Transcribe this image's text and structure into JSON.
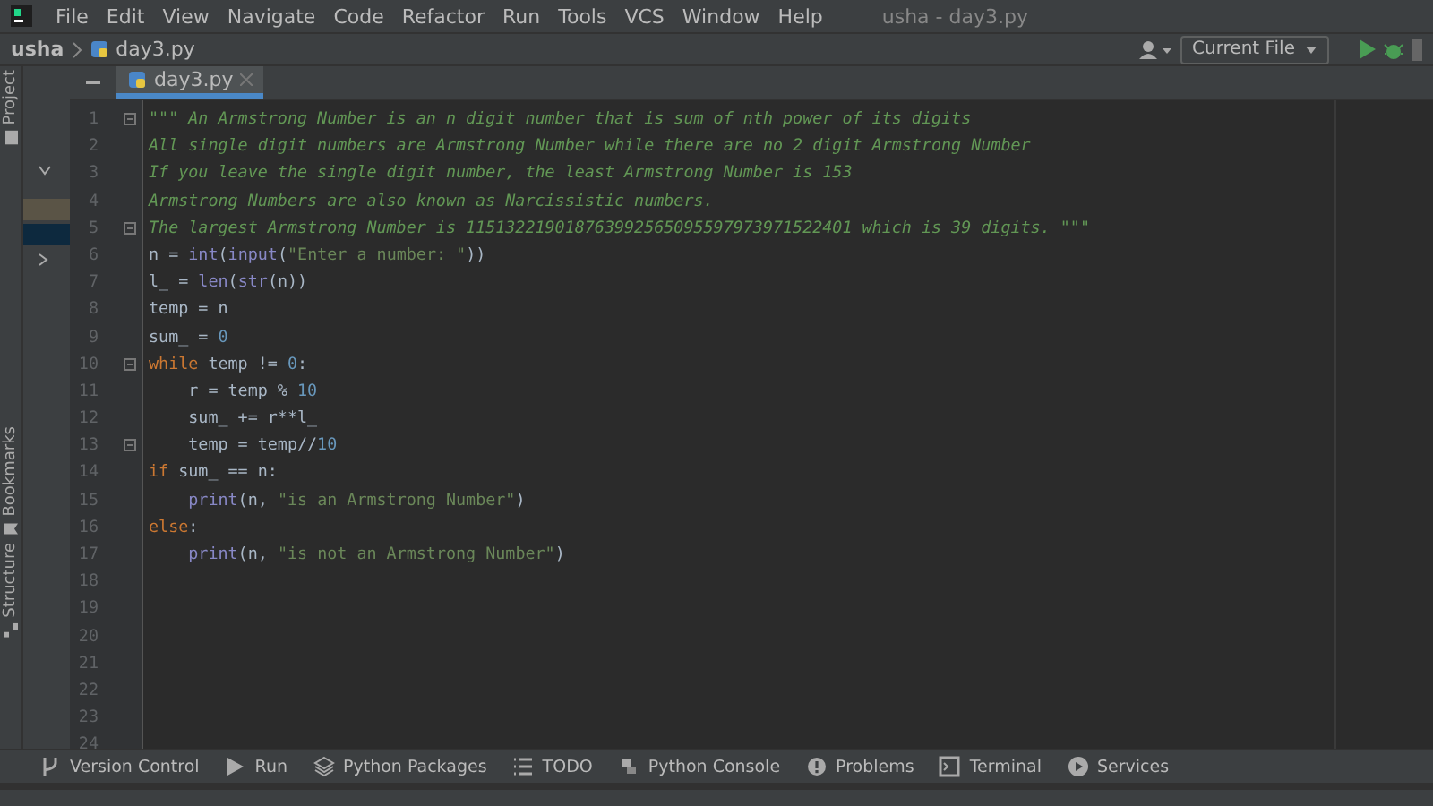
{
  "window": {
    "title": "usha - day3.py"
  },
  "menu": [
    "File",
    "Edit",
    "View",
    "Navigate",
    "Code",
    "Refactor",
    "Run",
    "Tools",
    "VCS",
    "Window",
    "Help"
  ],
  "navbar": {
    "project": "usha",
    "file": "day3.py",
    "run_config": "Current File"
  },
  "left_stripe": [
    "Project",
    "Bookmarks",
    "Structure"
  ],
  "tabs": [
    {
      "label": "day3.py",
      "selected": true
    }
  ],
  "editor": {
    "lines": [
      {
        "number": "1",
        "fold": true,
        "indented": false,
        "tokens": [
          {
            "kind": "doc",
            "t": "\"\"\" An Armstrong Number is an n digit number that is sum of nth power of its digits"
          }
        ]
      },
      {
        "number": "2",
        "fold": false,
        "indented": false,
        "tokens": [
          {
            "kind": "doc",
            "t": "All single digit numbers are Armstrong Number while there are no 2 digit Armstrong Number"
          }
        ]
      },
      {
        "number": "3",
        "fold": false,
        "indented": false,
        "tokens": [
          {
            "kind": "doc",
            "t": "If you leave the single digit number, the least Armstrong Number is 153"
          }
        ]
      },
      {
        "number": "4",
        "fold": false,
        "indented": false,
        "tokens": [
          {
            "kind": "doc",
            "t": "Armstrong Numbers are also known as Narcissistic numbers."
          }
        ]
      },
      {
        "number": "5",
        "fold": true,
        "indented": false,
        "tokens": [
          {
            "kind": "doc",
            "t": "The largest Armstrong Number is 115132219018763992565095597973971522401 which is 39 digits. \"\"\""
          }
        ]
      },
      {
        "number": "6",
        "fold": false,
        "indented": false,
        "tokens": [
          {
            "kind": "plain",
            "t": "n = "
          },
          {
            "kind": "builtin",
            "t": "int"
          },
          {
            "kind": "plain",
            "t": "("
          },
          {
            "kind": "builtin",
            "t": "input"
          },
          {
            "kind": "plain",
            "t": "("
          },
          {
            "kind": "string",
            "t": "\"Enter a number: \""
          },
          {
            "kind": "plain",
            "t": "))"
          }
        ]
      },
      {
        "number": "7",
        "fold": false,
        "indented": false,
        "tokens": [
          {
            "kind": "plain",
            "t": "l_ = "
          },
          {
            "kind": "builtin",
            "t": "len"
          },
          {
            "kind": "plain",
            "t": "("
          },
          {
            "kind": "builtin",
            "t": "str"
          },
          {
            "kind": "plain",
            "t": "(n))"
          }
        ]
      },
      {
        "number": "8",
        "fold": false,
        "indented": false,
        "tokens": [
          {
            "kind": "plain",
            "t": "temp = n"
          }
        ]
      },
      {
        "number": "9",
        "fold": false,
        "indented": false,
        "tokens": [
          {
            "kind": "plain",
            "t": "sum_ = "
          },
          {
            "kind": "number",
            "t": "0"
          }
        ]
      },
      {
        "number": "10",
        "fold": true,
        "indented": false,
        "tokens": [
          {
            "kind": "keyword",
            "t": "while"
          },
          {
            "kind": "plain",
            "t": " temp != "
          },
          {
            "kind": "number",
            "t": "0"
          },
          {
            "kind": "plain",
            "t": ":"
          }
        ]
      },
      {
        "number": "11",
        "fold": false,
        "indented": true,
        "tokens": [
          {
            "kind": "plain",
            "t": "r = temp % "
          },
          {
            "kind": "number",
            "t": "10"
          }
        ]
      },
      {
        "number": "12",
        "fold": false,
        "indented": true,
        "tokens": [
          {
            "kind": "plain",
            "t": "sum_ += r**l_"
          }
        ]
      },
      {
        "number": "13",
        "fold": true,
        "indented": true,
        "tokens": [
          {
            "kind": "plain",
            "t": "temp = temp//"
          },
          {
            "kind": "number",
            "t": "10"
          }
        ]
      },
      {
        "number": "14",
        "fold": false,
        "indented": false,
        "tokens": [
          {
            "kind": "keyword",
            "t": "if"
          },
          {
            "kind": "plain",
            "t": " sum_ == n:"
          }
        ]
      },
      {
        "number": "15",
        "fold": false,
        "indented": true,
        "tokens": [
          {
            "kind": "builtin",
            "t": "print"
          },
          {
            "kind": "plain",
            "t": "(n, "
          },
          {
            "kind": "string",
            "t": "\"is an Armstrong Number\""
          },
          {
            "kind": "plain",
            "t": ")"
          }
        ]
      },
      {
        "number": "16",
        "fold": false,
        "indented": false,
        "tokens": [
          {
            "kind": "keyword",
            "t": "else"
          },
          {
            "kind": "plain",
            "t": ":"
          }
        ]
      },
      {
        "number": "17",
        "fold": false,
        "indented": true,
        "tokens": [
          {
            "kind": "builtin",
            "t": "print"
          },
          {
            "kind": "plain",
            "t": "(n, "
          },
          {
            "kind": "string",
            "t": "\"is not an Armstrong Number\""
          },
          {
            "kind": "plain",
            "t": ")"
          }
        ]
      },
      {
        "number": "18",
        "fold": false
      },
      {
        "number": "19",
        "fold": false
      },
      {
        "number": "20",
        "fold": false
      },
      {
        "number": "21",
        "fold": false
      },
      {
        "number": "22",
        "fold": false
      },
      {
        "number": "23",
        "fold": false
      },
      {
        "number": "24",
        "fold": false
      }
    ]
  },
  "tool_windows": [
    {
      "kind": "vcs",
      "label": "Version Control"
    },
    {
      "kind": "run",
      "label": "Run"
    },
    {
      "kind": "packages",
      "label": "Python Packages"
    },
    {
      "kind": "todo",
      "label": "TODO"
    },
    {
      "kind": "console",
      "label": "Python Console"
    },
    {
      "kind": "problems",
      "label": "Problems"
    },
    {
      "kind": "terminal",
      "label": "Terminal"
    },
    {
      "kind": "services",
      "label": "Services"
    }
  ]
}
